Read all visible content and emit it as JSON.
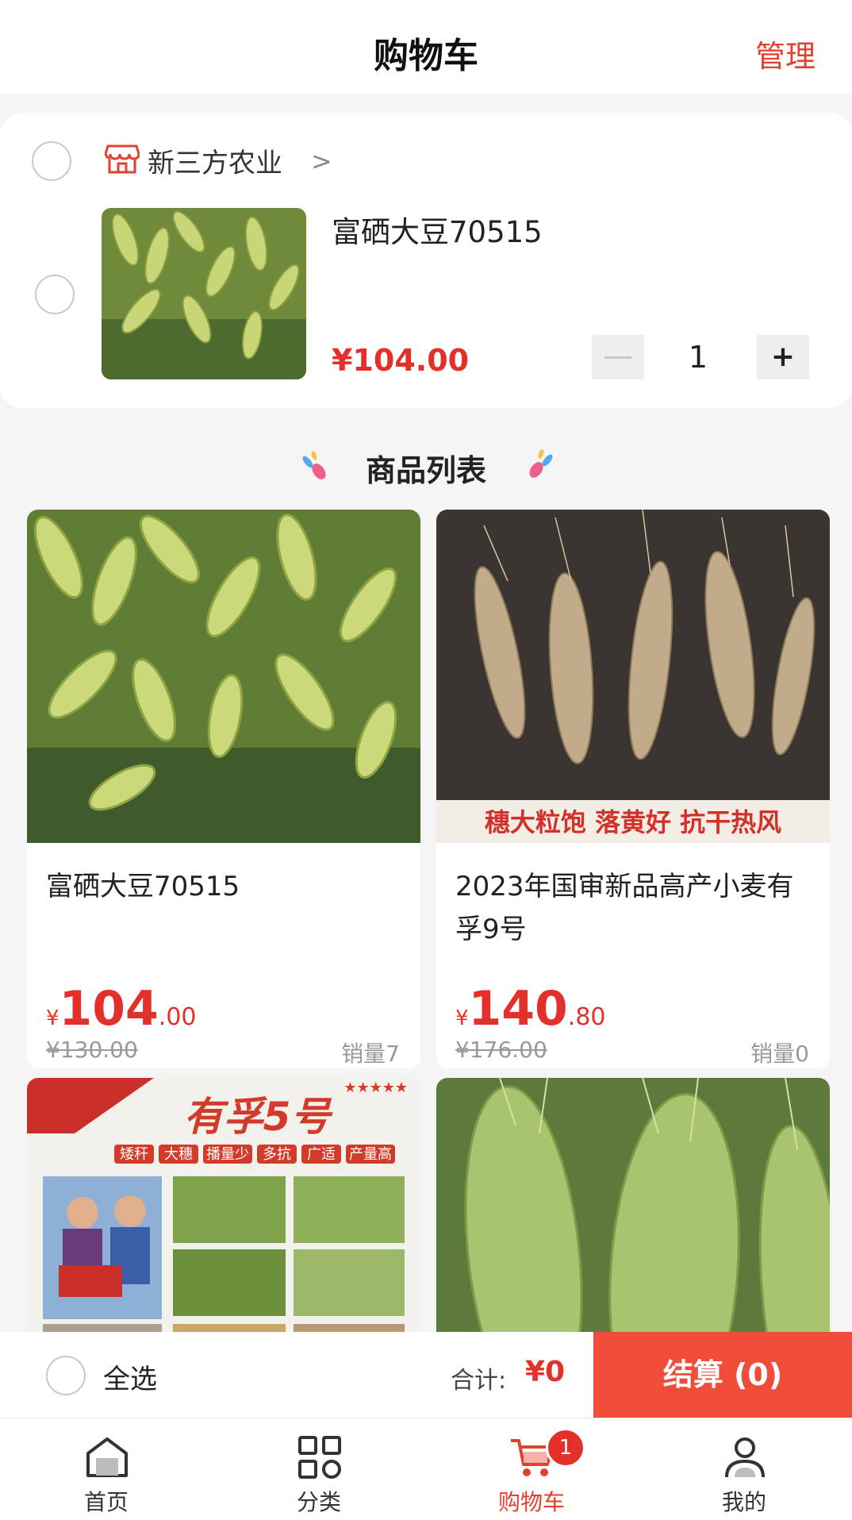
{
  "header": {
    "title": "购物车",
    "manage": "管理"
  },
  "cart": {
    "shop_name": "新三方农业",
    "item": {
      "name": "富硒大豆70515",
      "price": "¥104.00",
      "quantity": "1",
      "plus": "+"
    }
  },
  "section_title": "商品列表",
  "products": [
    {
      "name": "富硒大豆70515",
      "currency": "¥",
      "price_int": "104",
      "price_dec": ".00",
      "original": "¥130.00",
      "sales": "销量7"
    },
    {
      "name": "2023年国审新品高产小麦有孚9号",
      "currency": "¥",
      "price_int": "140",
      "price_dec": ".80",
      "original": "¥176.00",
      "sales": "销量0",
      "banner_text": "穗大粒饱 落黄好 抗干热风"
    },
    {
      "poster_title": "有孚5号",
      "poster_tags": [
        "矮秆",
        "大穗",
        "播量少",
        "多抗",
        "广适",
        "产量高"
      ]
    },
    {}
  ],
  "checkout": {
    "select_all": "全选",
    "total_label": "合计:",
    "total_value": "¥0",
    "button": "结算 (0)"
  },
  "tabs": [
    {
      "label": "首页",
      "icon": "home-icon"
    },
    {
      "label": "分类",
      "icon": "grid-icon"
    },
    {
      "label": "购物车",
      "icon": "cart-icon",
      "badge": "1",
      "active": true
    },
    {
      "label": "我的",
      "icon": "user-icon"
    }
  ],
  "colors": {
    "accent": "#e3302a",
    "checkout_button": "#f04c3a",
    "background": "#f5f5f5"
  }
}
